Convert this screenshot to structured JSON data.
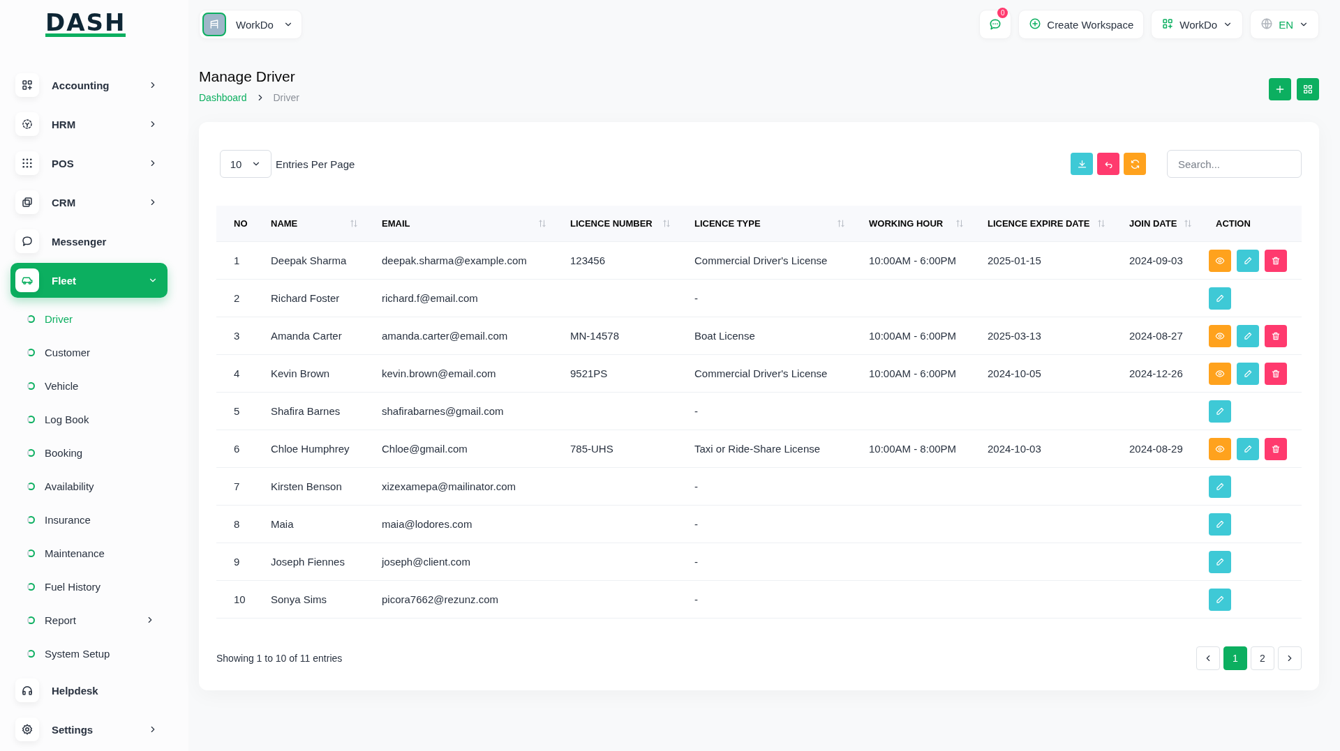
{
  "brand": {
    "logo": "DASH"
  },
  "topbar": {
    "workspace": "WorkDo",
    "notifications": "0",
    "create": "Create Workspace",
    "company": "WorkDo",
    "language": "EN"
  },
  "sidebar": {
    "items": [
      {
        "label": "Accounting",
        "submenu": true,
        "selected": false,
        "expanded": false
      },
      {
        "label": "HRM",
        "submenu": true,
        "selected": false,
        "expanded": false
      },
      {
        "label": "POS",
        "submenu": true,
        "selected": false,
        "expanded": false
      },
      {
        "label": "CRM",
        "submenu": true,
        "selected": false,
        "expanded": false
      },
      {
        "label": "Messenger",
        "submenu": false,
        "selected": false,
        "expanded": false
      },
      {
        "label": "Fleet",
        "submenu": true,
        "selected": true,
        "expanded": true,
        "children": [
          {
            "label": "Driver",
            "selected": true,
            "submenu": false
          },
          {
            "label": "Customer",
            "selected": false,
            "submenu": false
          },
          {
            "label": "Vehicle",
            "selected": false,
            "submenu": false
          },
          {
            "label": "Log Book",
            "selected": false,
            "submenu": false
          },
          {
            "label": "Booking",
            "selected": false,
            "submenu": false
          },
          {
            "label": "Availability",
            "selected": false,
            "submenu": false
          },
          {
            "label": "Insurance",
            "selected": false,
            "submenu": false
          },
          {
            "label": "Maintenance",
            "selected": false,
            "submenu": false
          },
          {
            "label": "Fuel History",
            "selected": false,
            "submenu": false
          },
          {
            "label": "Report",
            "selected": false,
            "submenu": true
          },
          {
            "label": "System Setup",
            "selected": false,
            "submenu": false
          }
        ]
      },
      {
        "label": "Helpdesk",
        "submenu": false,
        "selected": false,
        "expanded": false
      },
      {
        "label": "Settings",
        "submenu": true,
        "selected": false,
        "expanded": false
      }
    ]
  },
  "page": {
    "title": "Manage Driver",
    "breadcrumb": [
      "Dashboard",
      "Driver"
    ]
  },
  "toolbar": {
    "entries": "10",
    "entries_label": "Entries Per Page",
    "search_placeholder": "Search..."
  },
  "table": {
    "columns": [
      {
        "label": "NO",
        "sortable": false
      },
      {
        "label": "NAME",
        "sortable": true
      },
      {
        "label": "EMAIL",
        "sortable": true
      },
      {
        "label": "LICENCE NUMBER",
        "sortable": true
      },
      {
        "label": "LICENCE TYPE",
        "sortable": true
      },
      {
        "label": "WORKING HOUR",
        "sortable": true
      },
      {
        "label": "LICENCE EXPIRE DATE",
        "sortable": true
      },
      {
        "label": "JOIN DATE",
        "sortable": true
      },
      {
        "label": "ACTION",
        "sortable": false
      }
    ],
    "rows": [
      {
        "cells": [
          "1",
          "Deepak Sharma",
          "deepak.sharma@example.com",
          "123456",
          "Commercial Driver's License",
          "10:00AM - 6:00PM",
          "2025-01-15",
          "2024-09-03"
        ],
        "actions": [
          {
            "kind": "view"
          },
          {
            "kind": "edit"
          },
          {
            "kind": "delete"
          }
        ]
      },
      {
        "cells": [
          "2",
          "Richard Foster",
          "richard.f@email.com",
          "",
          "-",
          "",
          "",
          ""
        ],
        "actions": [
          {
            "kind": "edit"
          }
        ]
      },
      {
        "cells": [
          "3",
          "Amanda Carter",
          "amanda.carter@email.com",
          "MN-14578",
          "Boat License",
          "10:00AM - 6:00PM",
          "2025-03-13",
          "2024-08-27"
        ],
        "actions": [
          {
            "kind": "view"
          },
          {
            "kind": "edit"
          },
          {
            "kind": "delete"
          }
        ]
      },
      {
        "cells": [
          "4",
          "Kevin Brown",
          "kevin.brown@email.com",
          "9521PS",
          "Commercial Driver's License",
          "10:00AM - 6:00PM",
          "2024-10-05",
          "2024-12-26"
        ],
        "actions": [
          {
            "kind": "view"
          },
          {
            "kind": "edit"
          },
          {
            "kind": "delete"
          }
        ]
      },
      {
        "cells": [
          "5",
          "Shafira Barnes",
          "shafirabarnes@gmail.com",
          "",
          "-",
          "",
          "",
          ""
        ],
        "actions": [
          {
            "kind": "edit"
          }
        ]
      },
      {
        "cells": [
          "6",
          "Chloe Humphrey",
          "Chloe@gmail.com",
          "785-UHS",
          "Taxi or Ride-Share License",
          "10:00AM - 8:00PM",
          "2024-10-03",
          "2024-08-29"
        ],
        "actions": [
          {
            "kind": "view"
          },
          {
            "kind": "edit"
          },
          {
            "kind": "delete"
          }
        ]
      },
      {
        "cells": [
          "7",
          "Kirsten Benson",
          "xizexamepa@mailinator.com",
          "",
          "-",
          "",
          "",
          ""
        ],
        "actions": [
          {
            "kind": "edit"
          }
        ]
      },
      {
        "cells": [
          "8",
          "Maia",
          "maia@lodores.com",
          "",
          "-",
          "",
          "",
          ""
        ],
        "actions": [
          {
            "kind": "edit"
          }
        ]
      },
      {
        "cells": [
          "9",
          "Joseph Fiennes",
          "joseph@client.com",
          "",
          "-",
          "",
          "",
          ""
        ],
        "actions": [
          {
            "kind": "edit"
          }
        ]
      },
      {
        "cells": [
          "10",
          "Sonya Sims",
          "picora7662@rezunz.com",
          "",
          "-",
          "",
          "",
          ""
        ],
        "actions": [
          {
            "kind": "edit"
          }
        ]
      }
    ]
  },
  "footer": {
    "summary": "Showing 1 to 10 of 11 entries",
    "pages": [
      {
        "label": "1",
        "selected": true
      },
      {
        "label": "2",
        "selected": false
      }
    ]
  }
}
